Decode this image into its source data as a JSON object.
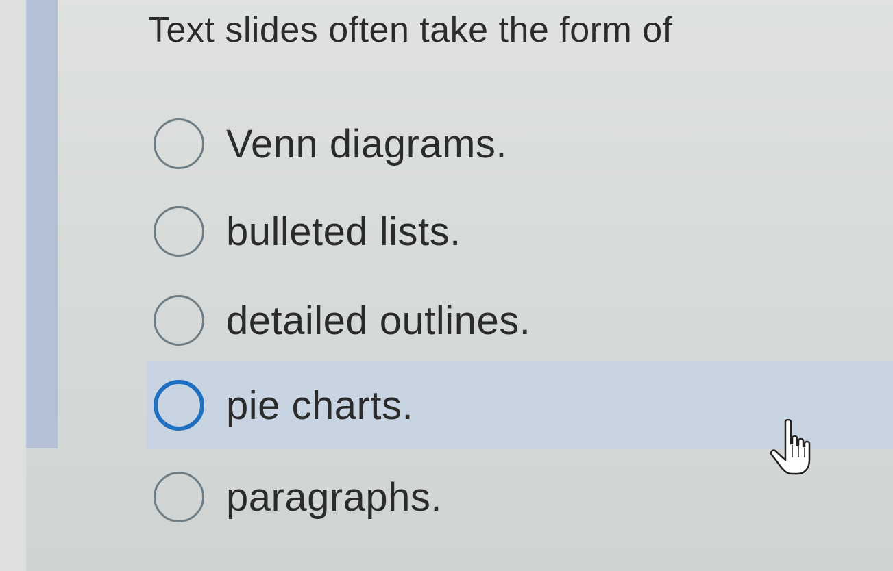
{
  "question": {
    "text": "Text slides often take the form of"
  },
  "options": [
    {
      "label": "Venn diagrams.",
      "selected": false,
      "hovered": false
    },
    {
      "label": "bulleted lists.",
      "selected": false,
      "hovered": false
    },
    {
      "label": "detailed outlines.",
      "selected": false,
      "hovered": false
    },
    {
      "label": "pie charts.",
      "selected": false,
      "hovered": true
    },
    {
      "label": "paragraphs.",
      "selected": false,
      "hovered": false
    }
  ],
  "colors": {
    "accent_bar": "#b3c0d6",
    "highlight_row": "#c8d4e1",
    "focus_radio": "#1e6fc0"
  },
  "cursor": {
    "icon": "hand-pointer-icon"
  }
}
